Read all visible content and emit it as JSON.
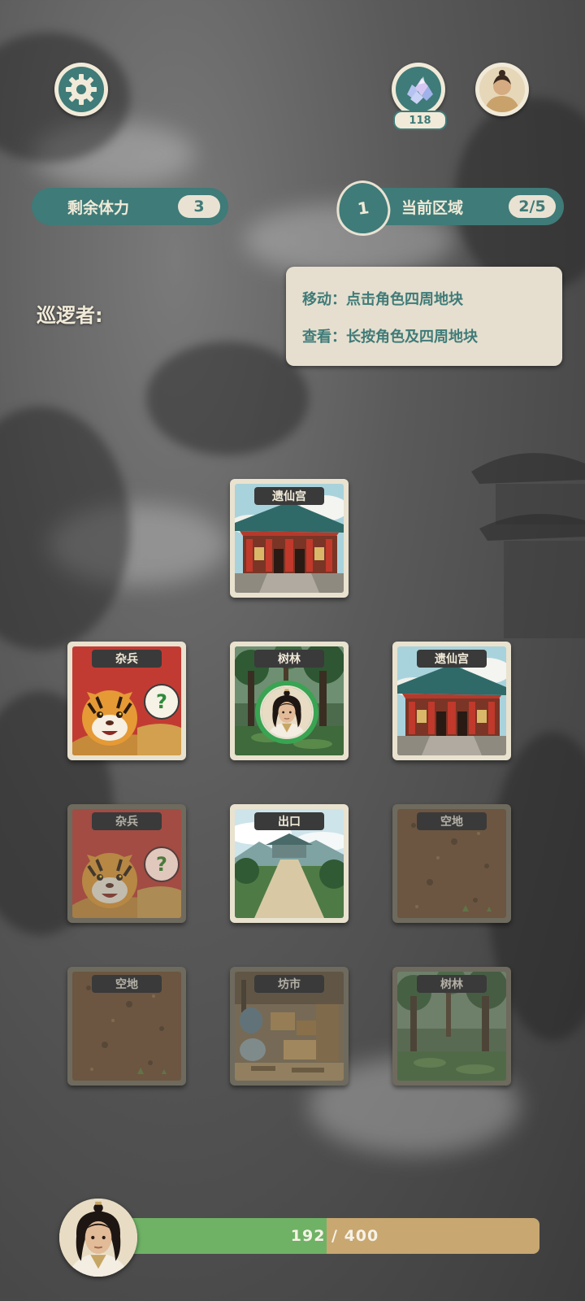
{
  "header": {
    "settings_icon": "gear-icon",
    "gem_icon": "crystal-gem-icon",
    "gem_count": "118",
    "profile_icon": "character-portrait-icon"
  },
  "stats": {
    "stamina_label": "剩余体力",
    "stamina_value": "3",
    "level": "1",
    "area_label": "当前区域",
    "area_value": "2/5"
  },
  "patrol_label": "巡逻者:",
  "hints": {
    "move": "移动：点击角色四周地块",
    "view": "查看：长按角色及四周地块"
  },
  "tiles": {
    "r0c1": {
      "label": "遗仙宫",
      "art": "palace"
    },
    "r1c0": {
      "label": "杂兵",
      "art": "tiger"
    },
    "r1c1": {
      "label": "树林",
      "art": "forest"
    },
    "r1c2": {
      "label": "遗仙宫",
      "art": "palace"
    },
    "r2c0": {
      "label": "杂兵",
      "art": "tiger"
    },
    "r2c1": {
      "label": "出口",
      "art": "exit-path"
    },
    "r2c2": {
      "label": "空地",
      "art": "dirt"
    },
    "r3c0": {
      "label": "空地",
      "art": "dirt"
    },
    "r3c1": {
      "label": "坊市",
      "art": "market"
    },
    "r3c2": {
      "label": "树林",
      "art": "forest"
    }
  },
  "unknown_marker": "?",
  "hp": {
    "current": 192,
    "max": 400,
    "text": "192 / 400"
  },
  "colors": {
    "teal": "#3f7b78",
    "cream": "#f1ead8",
    "hp_green": "#6fb266",
    "hp_track": "#c8a771",
    "enemy_red": "#b83a32"
  }
}
